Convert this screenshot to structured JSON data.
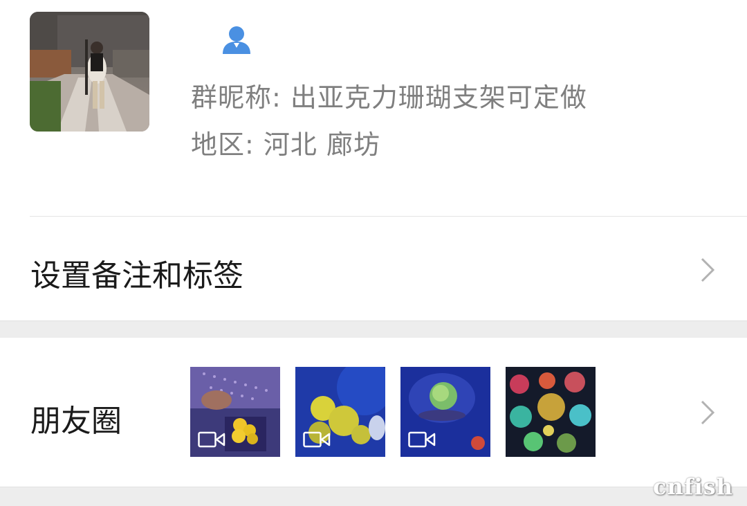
{
  "profile": {
    "avatar_name": "avatar",
    "group_nickname": "群昵称:  出亚克力珊瑚支架可定做",
    "region": "地区:  河北  廊坊"
  },
  "menu": {
    "remark_label": "设置备注和标签",
    "moments_label": "朋友圈"
  },
  "moments": {
    "thumbnails": [
      {
        "has_video": true
      },
      {
        "has_video": true
      },
      {
        "has_video": true
      },
      {
        "has_video": false
      }
    ]
  },
  "watermark": "cnfish"
}
